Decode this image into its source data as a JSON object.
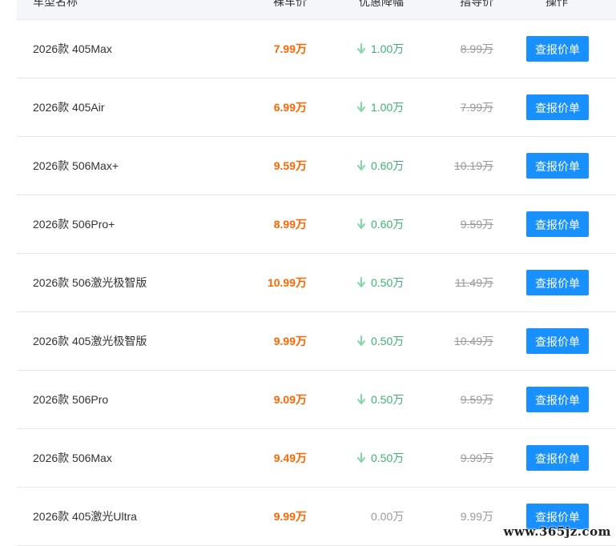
{
  "header": {
    "name": "车型名称",
    "price": "裸车价",
    "discount": "优惠降幅",
    "guide": "指导价",
    "action": "操作"
  },
  "rows": [
    {
      "name": "2026款 405Max",
      "price": "7.99万",
      "discount": "1.00万",
      "has_discount": true,
      "guide": "8.99万",
      "button": "查报价单"
    },
    {
      "name": "2026款 405Air",
      "price": "6.99万",
      "discount": "1.00万",
      "has_discount": true,
      "guide": "7.99万",
      "button": "查报价单"
    },
    {
      "name": "2026款 506Max+",
      "price": "9.59万",
      "discount": "0.60万",
      "has_discount": true,
      "guide": "10.19万",
      "button": "查报价单"
    },
    {
      "name": "2026款 506Pro+",
      "price": "8.99万",
      "discount": "0.60万",
      "has_discount": true,
      "guide": "9.59万",
      "button": "查报价单"
    },
    {
      "name": "2026款 506激光极智版",
      "price": "10.99万",
      "discount": "0.50万",
      "has_discount": true,
      "guide": "11.49万",
      "button": "查报价单"
    },
    {
      "name": "2026款 405激光极智版",
      "price": "9.99万",
      "discount": "0.50万",
      "has_discount": true,
      "guide": "10.49万",
      "button": "查报价单"
    },
    {
      "name": "2026款 506Pro",
      "price": "9.09万",
      "discount": "0.50万",
      "has_discount": true,
      "guide": "9.59万",
      "button": "查报价单"
    },
    {
      "name": "2026款 506Max",
      "price": "9.49万",
      "discount": "0.50万",
      "has_discount": true,
      "guide": "9.99万",
      "button": "查报价单"
    },
    {
      "name": "2026款 405激光Ultra",
      "price": "9.99万",
      "discount": "0.00万",
      "has_discount": false,
      "guide": "9.99万",
      "button": "查报价单"
    }
  ],
  "watermark": "www.365jz.com",
  "colors": {
    "price": "#ff6600",
    "discount": "#3cb371",
    "button": "#1890ff",
    "muted": "#999999"
  },
  "icons": {
    "discount": "arrow-down-icon"
  }
}
